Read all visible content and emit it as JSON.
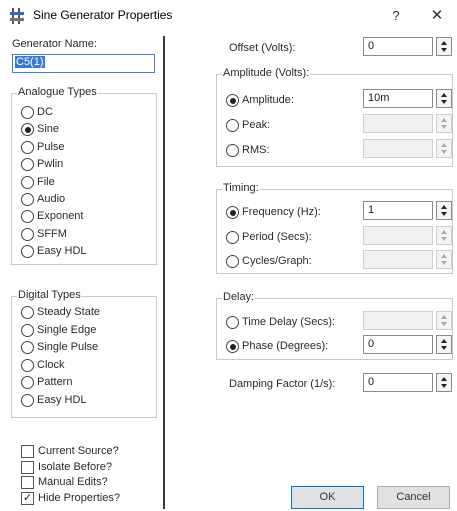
{
  "window": {
    "title": "Sine Generator Properties",
    "help": "?",
    "close": "✕"
  },
  "left": {
    "generator_name_label": "Generator Name:",
    "generator_name_value": "C5(1)",
    "analogue_types": {
      "title": "Analogue Types",
      "options": [
        {
          "label": "DC",
          "selected": false
        },
        {
          "label": "Sine",
          "selected": true
        },
        {
          "label": "Pulse",
          "selected": false
        },
        {
          "label": "Pwlin",
          "selected": false
        },
        {
          "label": "File",
          "selected": false
        },
        {
          "label": "Audio",
          "selected": false
        },
        {
          "label": "Exponent",
          "selected": false
        },
        {
          "label": "SFFM",
          "selected": false
        },
        {
          "label": "Easy HDL",
          "selected": false
        }
      ]
    },
    "digital_types": {
      "title": "Digital Types",
      "options": [
        {
          "label": "Steady State",
          "selected": false
        },
        {
          "label": "Single Edge",
          "selected": false
        },
        {
          "label": "Single Pulse",
          "selected": false
        },
        {
          "label": "Clock",
          "selected": false
        },
        {
          "label": "Pattern",
          "selected": false
        },
        {
          "label": "Easy HDL",
          "selected": false
        }
      ]
    },
    "checkboxes": [
      {
        "label": "Current Source?",
        "checked": false
      },
      {
        "label": "Isolate Before?",
        "checked": false
      },
      {
        "label": "Manual Edits?",
        "checked": false
      },
      {
        "label": "Hide Properties?",
        "checked": true
      }
    ]
  },
  "right": {
    "offset": {
      "label": "Offset (Volts):",
      "value": "0"
    },
    "amplitude": {
      "title": "Amplitude (Volts):",
      "amplitude_label": "Amplitude:",
      "amplitude_value": "10m",
      "peak_label": "Peak:",
      "rms_label": "RMS:",
      "selected": "Amplitude"
    },
    "timing": {
      "title": "Timing:",
      "frequency_label": "Frequency (Hz):",
      "frequency_value": "1",
      "period_label": "Period (Secs):",
      "cycles_label": "Cycles/Graph:",
      "selected": "Frequency"
    },
    "delay": {
      "title": "Delay:",
      "time_delay_label": "Time Delay (Secs):",
      "phase_label": "Phase (Degrees):",
      "phase_value": "0",
      "selected": "Phase"
    },
    "damping": {
      "label": "Damping Factor (1/s):",
      "value": "0"
    }
  },
  "buttons": {
    "ok": "OK",
    "cancel": "Cancel"
  }
}
